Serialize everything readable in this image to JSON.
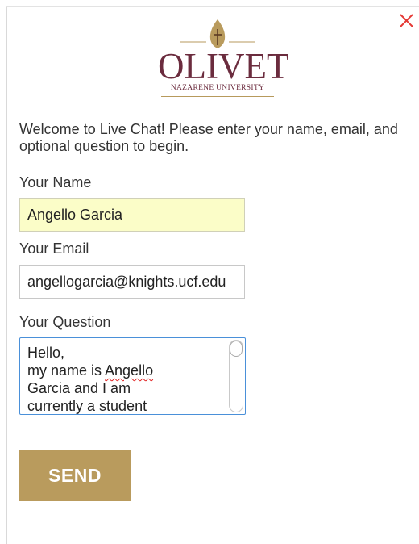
{
  "header": {
    "logo": {
      "name": "OLIVET",
      "subtitle": "NAZARENE UNIVERSITY",
      "emblem": "flame-cross-icon",
      "primary_color": "#6b2c3e",
      "accent_color": "#b99b5d"
    },
    "close_icon": "close-icon",
    "close_color": "#e53935"
  },
  "form": {
    "welcome_text": "Welcome to Live Chat! Please enter your name, email, and optional question to begin.",
    "name": {
      "label": "Your Name",
      "value": "Angello Garcia"
    },
    "email": {
      "label": "Your Email",
      "value": "angellogarcia@knights.ucf.edu"
    },
    "question": {
      "label": "Your Question",
      "line1": "Hello,",
      "line2_prefix": "my name is ",
      "line2_misspelled": "Angello",
      "line3": "Garcia and I am",
      "line4": "currently a student"
    },
    "send_label": "SEND",
    "send_color": "#b99b5d"
  }
}
